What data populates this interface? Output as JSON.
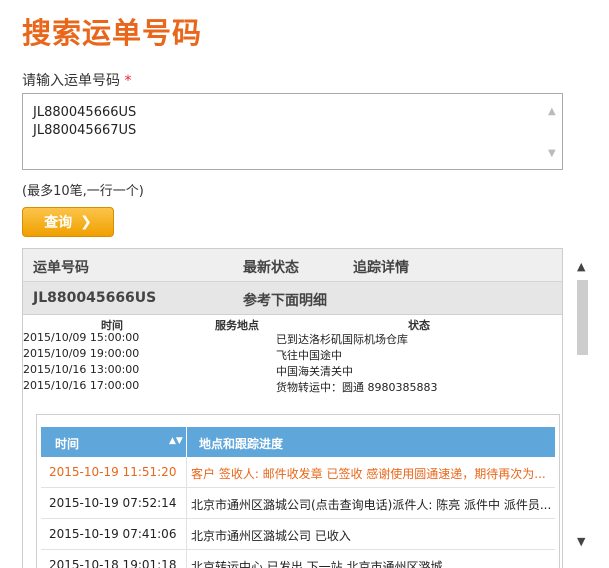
{
  "page_title": "搜索运单号码",
  "form": {
    "label": "请输入运单号码",
    "required_mark": "*",
    "tracking_numbers": [
      "JL880045666US",
      "JL880045667US"
    ],
    "hint": "(最多10笔,一行一个)",
    "submit_label": "查询"
  },
  "results": {
    "columns": [
      "运单号码",
      "最新状态",
      "追踪详情"
    ],
    "item": {
      "number": "JL880045666US",
      "status": "参考下面明细"
    },
    "events_header": {
      "time": "时间",
      "location": "服务地点",
      "status": "状态"
    },
    "events": [
      {
        "time": "2015/10/09 15:00:00",
        "status": "已到达洛杉矶国际机场仓库"
      },
      {
        "time": "2015/10/09 19:00:00",
        "status": "飞往中国途中"
      },
      {
        "time": "2015/10/16 13:00:00",
        "status": "中国海关清关中"
      },
      {
        "time": "2015/10/16 17:00:00",
        "status": "货物转运中：圆通 8980385883"
      }
    ],
    "detail": {
      "col_time": "时间",
      "col_progress": "地点和跟踪进度",
      "rows": [
        {
          "time": "2015-10-19 11:51:20",
          "text": "客户 签收人: 邮件收发章 已签收 感谢使用圆通速递，期待再次为..."
        },
        {
          "time": "2015-10-19 07:52:14",
          "text": "北京市通州区潞城公司(点击查询电话)派件人: 陈亮 派件中 派件员..."
        },
        {
          "time": "2015-10-19 07:41:06",
          "text": "北京市通州区潞城公司 已收入"
        },
        {
          "time": "2015-10-18 19:01:18",
          "text": "北京转运中心 已发出,下一站 北京市通州区潞城"
        }
      ]
    }
  },
  "colors": {
    "accent": "#e8671b",
    "button": "#f0a000",
    "table_header": "#5fa6db"
  }
}
